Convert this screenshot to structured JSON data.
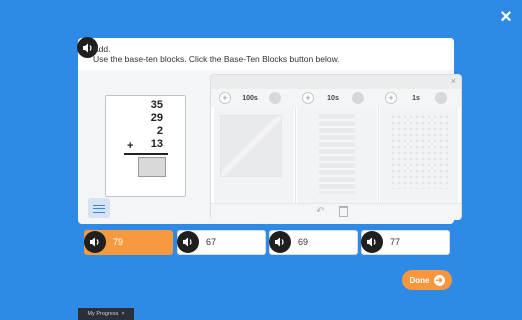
{
  "instructions": {
    "line1": "Add.",
    "line2": "Use the base-ten blocks. Click the Base-Ten Blocks button below."
  },
  "problem": {
    "addends": [
      "35",
      "29",
      "2",
      "13"
    ],
    "operator": "+"
  },
  "base_ten_tool": {
    "close": "×",
    "columns": [
      {
        "label": "100s"
      },
      {
        "label": "10s"
      },
      {
        "label": "1s"
      }
    ],
    "plus": "+",
    "undo": "↶"
  },
  "choices": [
    {
      "value": "79",
      "selected": true
    },
    {
      "value": "67",
      "selected": false
    },
    {
      "value": "69",
      "selected": false
    },
    {
      "value": "77",
      "selected": false
    }
  ],
  "done_label": "Done",
  "close_label": "×",
  "progress_tab": {
    "label": "My Progress",
    "close": "×"
  },
  "colors": {
    "background": "#2f8ae6",
    "accent": "#f7963c"
  }
}
